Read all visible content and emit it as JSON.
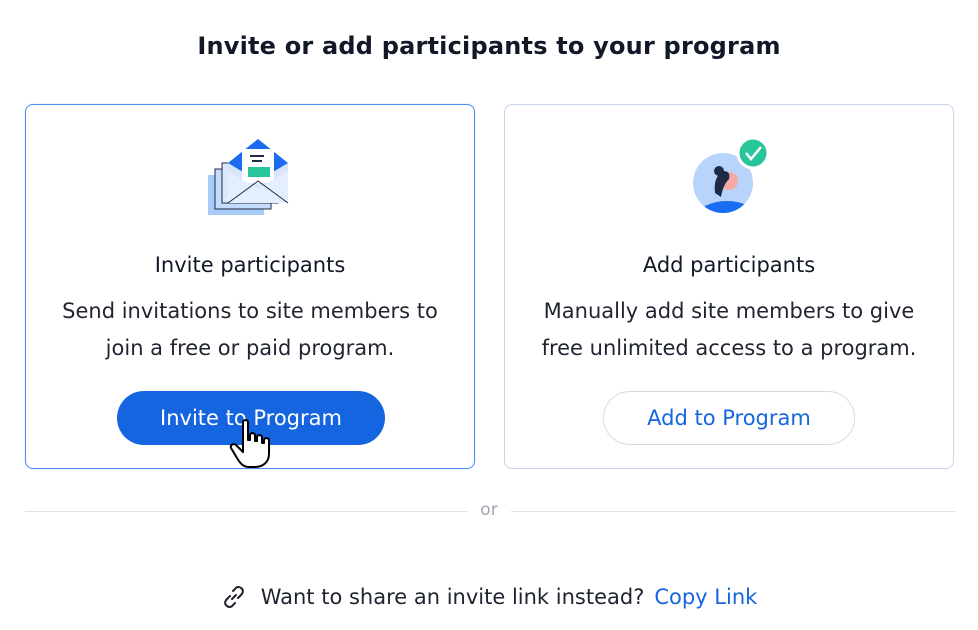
{
  "page": {
    "title": "Invite or add participants to your program"
  },
  "cards": [
    {
      "id": "invite",
      "icon": "envelope-invite-icon",
      "heading": "Invite participants",
      "description": "Send invitations to site members to join a free or paid program.",
      "button_label": "Invite to Program"
    },
    {
      "id": "add",
      "icon": "person-check-icon",
      "heading": "Add participants",
      "description": "Manually add site members to give free unlimited access to a program.",
      "button_label": "Add to Program"
    }
  ],
  "divider": {
    "label": "or"
  },
  "footer": {
    "icon": "link-icon",
    "prompt": "Want to share an invite link instead?",
    "link_label": "Copy Link"
  },
  "colors": {
    "accent": "#1665e0",
    "selected_border": "#4d8ef7",
    "check_badge": "#28c59a"
  }
}
